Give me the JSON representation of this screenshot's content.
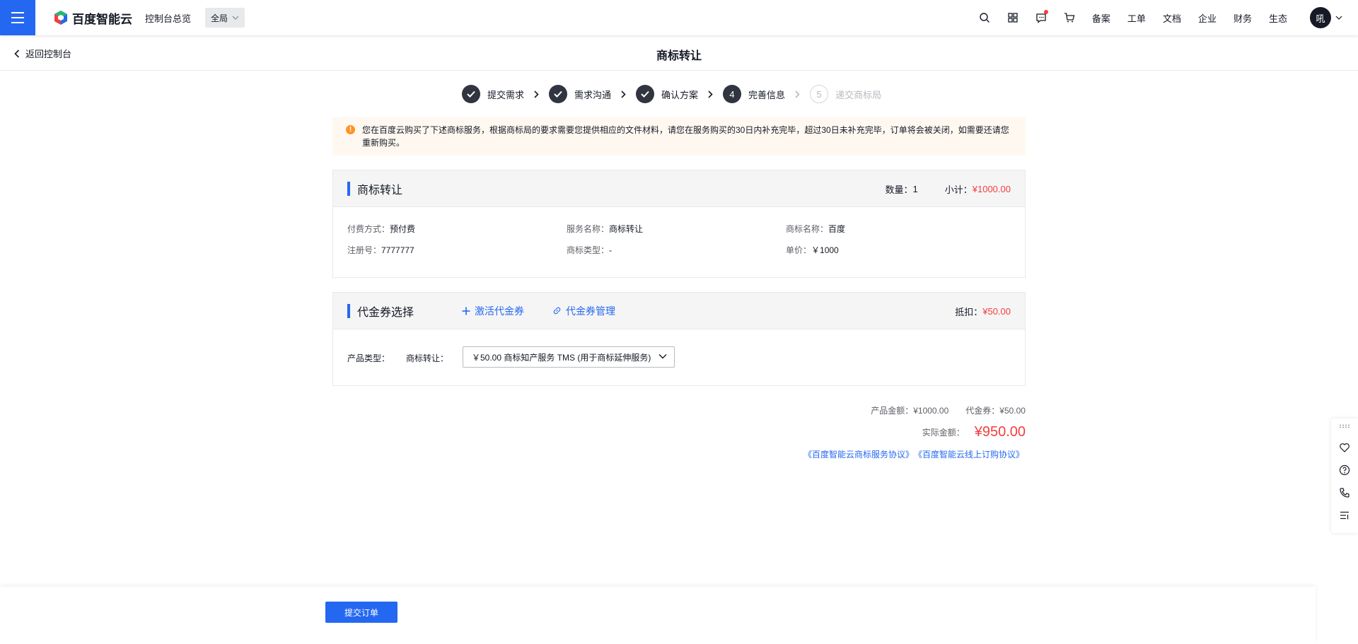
{
  "topbar": {
    "logo_text": "百度智能云",
    "overview": "控制台总览",
    "region": "全局",
    "links": [
      "备案",
      "工单",
      "文档",
      "企业",
      "财务",
      "生态"
    ],
    "avatar_text": "吼"
  },
  "subheader": {
    "back_label": "返回控制台",
    "title": "商标转让"
  },
  "steps": [
    {
      "label": "提交需求",
      "state": "done",
      "num": ""
    },
    {
      "label": "需求沟通",
      "state": "done",
      "num": ""
    },
    {
      "label": "确认方案",
      "state": "done",
      "num": ""
    },
    {
      "label": "完善信息",
      "state": "current",
      "num": "4"
    },
    {
      "label": "递交商标局",
      "state": "pending",
      "num": "5"
    }
  ],
  "alert": {
    "text": "您在百度云购买了下述商标服务，根据商标局的要求需要您提供相应的文件材料，请您在服务购买的30日内补充完毕，超过30日未补充完毕，订单将会被关闭，如需要还请您重新购买。"
  },
  "order": {
    "title": "商标转让",
    "qty_label": "数量：",
    "qty": "1",
    "subtotal_label": "小计：",
    "subtotal": "¥1000.00",
    "fields": [
      {
        "label": "付费方式：",
        "value": "预付费"
      },
      {
        "label": "服务名称：",
        "value": "商标转让"
      },
      {
        "label": "商标名称：",
        "value": "百度"
      },
      {
        "label": "注册号：",
        "value": "7777777"
      },
      {
        "label": "商标类型：",
        "value": "-"
      },
      {
        "label": "单价：",
        "value": "￥1000"
      }
    ]
  },
  "voucher": {
    "title": "代金券选择",
    "activate": "激活代金券",
    "manage": "代金券管理",
    "deduct_label": "抵扣：",
    "deduct": "¥50.00",
    "product_type_label": "产品类型：",
    "product_label": "商标转让：",
    "selected": "￥50.00 商标知产服务 TMS (用于商标延伸服务)"
  },
  "summary": {
    "product_amount": "产品金额：¥1000.00",
    "voucher_amount": "代金券：¥50.00",
    "actual_label": "实际金额：",
    "actual": "¥950.00",
    "agreement1": "《百度智能云商标服务协议》",
    "agreement2": "《百度智能云线上订购协议》"
  },
  "bottom": {
    "submit": "提交订单"
  },
  "colors": {
    "primary": "#2468f2",
    "price": "#f33e3e",
    "warning": "#ff9326"
  }
}
